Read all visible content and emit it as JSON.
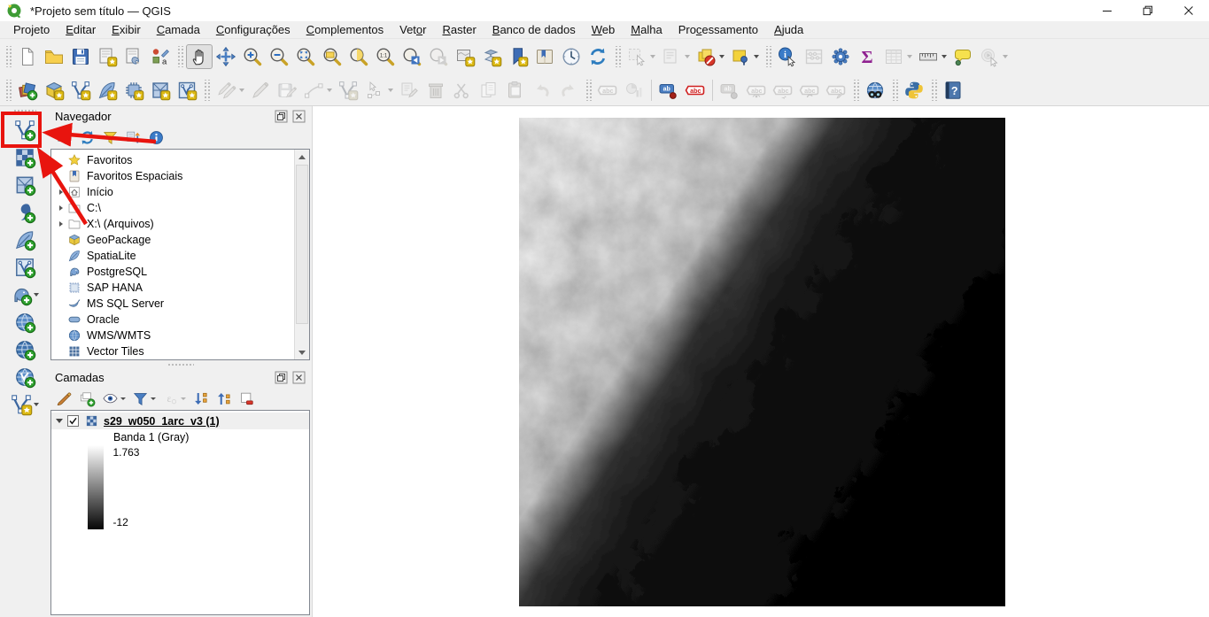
{
  "window": {
    "title": "*Projeto sem título — QGIS",
    "controls": [
      "minimize",
      "restore",
      "close"
    ]
  },
  "menubar": {
    "items": [
      {
        "label": "Projeto",
        "accel": 3
      },
      {
        "label": "Editar",
        "accel": 0
      },
      {
        "label": "Exibir",
        "accel": 0
      },
      {
        "label": "Camada",
        "accel": 0
      },
      {
        "label": "Configurações",
        "accel": 0
      },
      {
        "label": "Complementos",
        "accel": 0
      },
      {
        "label": "Vetor",
        "accel": 3
      },
      {
        "label": "Raster",
        "accel": 0
      },
      {
        "label": "Banco de dados",
        "accel": 0
      },
      {
        "label": "Web",
        "accel": 0
      },
      {
        "label": "Malha",
        "accel": 0
      },
      {
        "label": "Processamento",
        "accel": 3
      },
      {
        "label": "Ajuda",
        "accel": 0
      }
    ]
  },
  "toolbars": {
    "row1": [
      {
        "sep": "handle",
        "buttons": [
          {
            "name": "new-project",
            "icon": "page"
          },
          {
            "name": "open-project",
            "icon": "folder"
          },
          {
            "name": "save-project",
            "icon": "floppy"
          },
          {
            "name": "new-print-layout",
            "icon": "layout-new"
          },
          {
            "name": "show-layout-manager",
            "icon": "layout-manager"
          },
          {
            "name": "style-manager",
            "icon": "symbology"
          }
        ]
      },
      {
        "sep": "handle",
        "buttons": [
          {
            "name": "pan-map",
            "icon": "hand",
            "active": true
          },
          {
            "name": "pan-to-selection",
            "icon": "move"
          },
          {
            "name": "zoom-in",
            "icon": "mag-plus"
          },
          {
            "name": "zoom-out",
            "icon": "mag-minus"
          },
          {
            "name": "zoom-full",
            "icon": "mag-full"
          },
          {
            "name": "zoom-to-layer",
            "icon": "mag-layer"
          },
          {
            "name": "zoom-to-selection",
            "icon": "mag-selection"
          },
          {
            "name": "zoom-native-resolution",
            "icon": "mag-native"
          },
          {
            "name": "zoom-last",
            "icon": "mag-last"
          },
          {
            "name": "zoom-next",
            "icon": "mag-next",
            "disabled": true
          },
          {
            "name": "new-map-view",
            "icon": "map-view"
          },
          {
            "name": "new-3d-map-view",
            "icon": "map-3d"
          },
          {
            "name": "new-spatial-bookmark",
            "icon": "bookmark-new"
          },
          {
            "name": "show-spatial-bookmarks",
            "icon": "bookmarks"
          },
          {
            "name": "temporal-controller",
            "icon": "clock"
          },
          {
            "name": "refresh-map",
            "icon": "refresh"
          }
        ]
      },
      {
        "sep": "handle",
        "buttons": [
          {
            "name": "select-features",
            "icon": "select-rect",
            "disabled": true,
            "dropdown": true
          },
          {
            "name": "select-features-by-value",
            "icon": "select-form",
            "disabled": true,
            "dropdown": true
          },
          {
            "name": "deselect-features-all-layers",
            "icon": "deselect",
            "dropdown": true
          },
          {
            "name": "select-by-location",
            "icon": "select-location",
            "dropdown": true
          }
        ]
      },
      {
        "sep": "handle",
        "buttons": [
          {
            "name": "identify-features",
            "icon": "identify"
          },
          {
            "name": "field-calculator",
            "icon": "abacus",
            "disabled": true
          },
          {
            "name": "processing-toolbox",
            "icon": "gear"
          },
          {
            "name": "statistical-summary",
            "icon": "sigma"
          },
          {
            "name": "open-attribute-table",
            "icon": "table",
            "disabled": true,
            "dropdown": true
          },
          {
            "name": "measure",
            "icon": "ruler",
            "dropdown": true
          },
          {
            "name": "map-tips",
            "icon": "map-tip"
          },
          {
            "name": "run-feature-action",
            "icon": "action",
            "disabled": true,
            "dropdown": true
          }
        ]
      }
    ],
    "row2": [
      {
        "sep": "handle",
        "buttons": [
          {
            "name": "open-data-source-manager",
            "icon": "ds-manager"
          },
          {
            "name": "new-geopackage-layer",
            "icon": "geopackage-new"
          },
          {
            "name": "new-shapefile-layer",
            "icon": "vnode-star"
          },
          {
            "name": "new-spatialite-layer",
            "icon": "feather-star"
          },
          {
            "name": "new-temporary-scratch-layer",
            "icon": "chip-star"
          },
          {
            "name": "new-mesh-layer",
            "icon": "mesh-star"
          },
          {
            "name": "new-virtual-layer",
            "icon": "vbox-star"
          }
        ]
      },
      {
        "sep": "handle",
        "buttons": [
          {
            "name": "current-edits",
            "icon": "pencils",
            "disabled": true,
            "dropdown": true
          },
          {
            "name": "toggle-editing",
            "icon": "pencil",
            "disabled": true
          },
          {
            "name": "save-layer-edits",
            "icon": "floppy-pencil",
            "disabled": true
          },
          {
            "name": "digitize-with-segment",
            "icon": "digitize",
            "disabled": true,
            "dropdown": true
          },
          {
            "name": "add-feature",
            "icon": "vnode-star",
            "disabled": true
          },
          {
            "name": "vertex-tool",
            "icon": "vertex-tool",
            "disabled": true,
            "dropdown": true
          },
          {
            "name": "modify-attributes",
            "icon": "form-edit",
            "disabled": true
          },
          {
            "name": "delete-selected",
            "icon": "trash",
            "disabled": true
          },
          {
            "name": "cut-features",
            "icon": "scissors",
            "disabled": true
          },
          {
            "name": "copy-features",
            "icon": "copy",
            "disabled": true
          },
          {
            "name": "paste-features",
            "icon": "paste",
            "disabled": true
          },
          {
            "name": "undo",
            "icon": "undo",
            "disabled": true
          },
          {
            "name": "redo",
            "icon": "redo",
            "disabled": true
          }
        ]
      },
      {
        "sep": "handle",
        "buttons": [
          {
            "name": "layer-labeling-options",
            "icon": "abc-tag-gray",
            "disabled": true
          },
          {
            "name": "layer-diagram-options",
            "icon": "diagram",
            "disabled": true
          }
        ]
      },
      {
        "sep": "line",
        "buttons": [
          {
            "name": "highlight-pinned-labels",
            "icon": "ab-pin"
          },
          {
            "name": "show-unplaced-labels",
            "icon": "abc-tag-red"
          }
        ]
      },
      {
        "sep": "line",
        "buttons": [
          {
            "name": "pin-unpin-labels",
            "icon": "ab-pin-gray",
            "disabled": true
          },
          {
            "name": "show-hide-labels",
            "icon": "abc-eye",
            "disabled": true
          },
          {
            "name": "move-label",
            "icon": "abc-move",
            "disabled": true
          },
          {
            "name": "rotate-label",
            "icon": "abc-rotate",
            "disabled": true
          },
          {
            "name": "change-label-properties",
            "icon": "abc-edit",
            "disabled": true
          }
        ]
      },
      {
        "sep": "handle",
        "buttons": [
          {
            "name": "metasearch",
            "icon": "metasearch"
          }
        ]
      },
      {
        "sep": "handle",
        "buttons": [
          {
            "name": "python-console",
            "icon": "python"
          }
        ]
      },
      {
        "sep": "handle",
        "buttons": [
          {
            "name": "help",
            "icon": "help"
          }
        ]
      }
    ],
    "left_rail": [
      {
        "name": "add-vector-layer",
        "icon": "vnode-plus",
        "highlighted": true
      },
      {
        "name": "add-raster-layer",
        "icon": "checker-plus"
      },
      {
        "name": "add-mesh-layer",
        "icon": "mesh-plus"
      },
      {
        "name": "add-delimited-text-layer",
        "icon": "comma-plus"
      },
      {
        "name": "add-spatialite-layer",
        "icon": "feather-plus"
      },
      {
        "name": "add-virtual-layer",
        "icon": "vbox-plus"
      },
      {
        "name": "add-postgis-layer",
        "icon": "elephant-plus",
        "dropdown": true
      },
      {
        "name": "add-wms-wmts-layer",
        "icon": "globe-plus"
      },
      {
        "name": "add-wcs-layer",
        "icon": "globe2-plus"
      },
      {
        "name": "add-wfs-layer",
        "icon": "globev-plus"
      },
      {
        "name": "new-shapefile-layer",
        "icon": "vnode-star",
        "dropdown": true
      }
    ]
  },
  "browser_panel": {
    "title": "Navegador",
    "tools": [
      {
        "name": "add-selected-layers",
        "icon": "add-layer"
      },
      {
        "name": "refresh-browser",
        "icon": "refresh"
      },
      {
        "name": "filter-browser",
        "icon": "funnel-yellow"
      },
      {
        "name": "collapse-all",
        "icon": "collapse-tree"
      },
      {
        "name": "show-properties",
        "icon": "info"
      }
    ],
    "items": [
      {
        "label": "Favoritos",
        "icon": "star"
      },
      {
        "label": "Favoritos Espaciais",
        "icon": "spatial-bookmark"
      },
      {
        "label": "Início",
        "icon": "home",
        "expandable": true
      },
      {
        "label": "C:\\",
        "icon": "folder-outline",
        "expandable": true
      },
      {
        "label": "X:\\ (Arquivos)",
        "icon": "folder-outline",
        "expandable": true
      },
      {
        "label": "GeoPackage",
        "icon": "geopackage"
      },
      {
        "label": "SpatiaLite",
        "icon": "feather"
      },
      {
        "label": "PostgreSQL",
        "icon": "elephant"
      },
      {
        "label": "SAP HANA",
        "icon": "sap-box"
      },
      {
        "label": "MS SQL Server",
        "icon": "mssql"
      },
      {
        "label": "Oracle",
        "icon": "oracle"
      },
      {
        "label": "WMS/WMTS",
        "icon": "globe"
      },
      {
        "label": "Vector Tiles",
        "icon": "vtiles"
      }
    ]
  },
  "layers_panel": {
    "title": "Camadas",
    "tools": [
      {
        "name": "open-layer-styling",
        "icon": "paintbrush"
      },
      {
        "name": "add-group",
        "icon": "add-group"
      },
      {
        "name": "manage-map-themes",
        "icon": "eye",
        "dropdown": true
      },
      {
        "name": "filter-legend",
        "icon": "funnel-blue",
        "dropdown": true
      },
      {
        "name": "filter-by-expression",
        "icon": "epsilon",
        "disabled": true,
        "dropdown": true
      },
      {
        "name": "expand-all",
        "icon": "expand-all"
      },
      {
        "name": "collapse-all-layers",
        "icon": "collapse-all"
      },
      {
        "name": "remove-layer",
        "icon": "remove-layer"
      }
    ],
    "layer": {
      "name": "s29_w050_1arc_v3 (1)",
      "checked": true,
      "band": "Banda 1 (Gray)",
      "ramp_max": "1.763",
      "ramp_min": "-12"
    }
  },
  "annotations": {
    "color": "#e8140e",
    "note": "red box around add-vector-layer button with two arrows pointing at it"
  }
}
